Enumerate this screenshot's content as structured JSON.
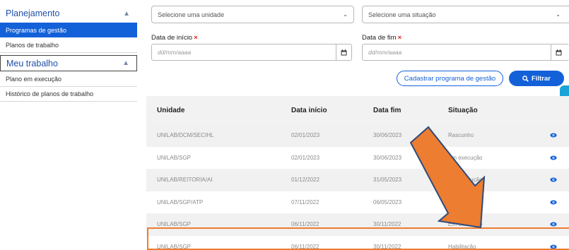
{
  "sidebar": {
    "section1": {
      "title": "Planejamento",
      "chevron": "chevron-up-icon"
    },
    "items1": [
      "Programas de gestão",
      "Planos de trabalho"
    ],
    "section2": {
      "title": "Meu trabalho",
      "chevron": "chevron-up-icon"
    },
    "items2": [
      "Plano em execução",
      "Histórico de planos de trabalho"
    ]
  },
  "filters": {
    "unit_placeholder": "Selecione uma unidade",
    "status_placeholder": "Selecione uma situação",
    "start_label": "Data de início",
    "end_label": "Data de fim",
    "required_mark": "×",
    "date_placeholder": "dd/mm/aaaa"
  },
  "actions": {
    "register_label": "Cadastrar programa de gestão",
    "filter_label": "Filtrar"
  },
  "table": {
    "headers": [
      "Unidade",
      "Data início",
      "Data fim",
      "Situação"
    ],
    "rows": [
      [
        "UNILAB/DCM/SECIHL",
        "02/01/2023",
        "30/06/2023",
        "Rascunho"
      ],
      [
        "UNILAB/SGP",
        "02/01/2023",
        "30/06/2023",
        "Em execução"
      ],
      [
        "UNILAB/REITORIA/AI",
        "01/12/2022",
        "31/05/2023",
        "Em execução"
      ],
      [
        "UNILAB/SGP/ATP",
        "07/11/2022",
        "06/05/2023",
        ""
      ],
      [
        "UNILAB/SGP",
        "06/11/2022",
        "30/11/2022",
        "Em execução"
      ],
      [
        "UNILAB/SGP",
        "06/11/2022",
        "30/11/2022",
        "Habilitação"
      ]
    ]
  },
  "colors": {
    "primary": "#1361d9",
    "accent": "#ed7d31",
    "required": "#e02020"
  }
}
